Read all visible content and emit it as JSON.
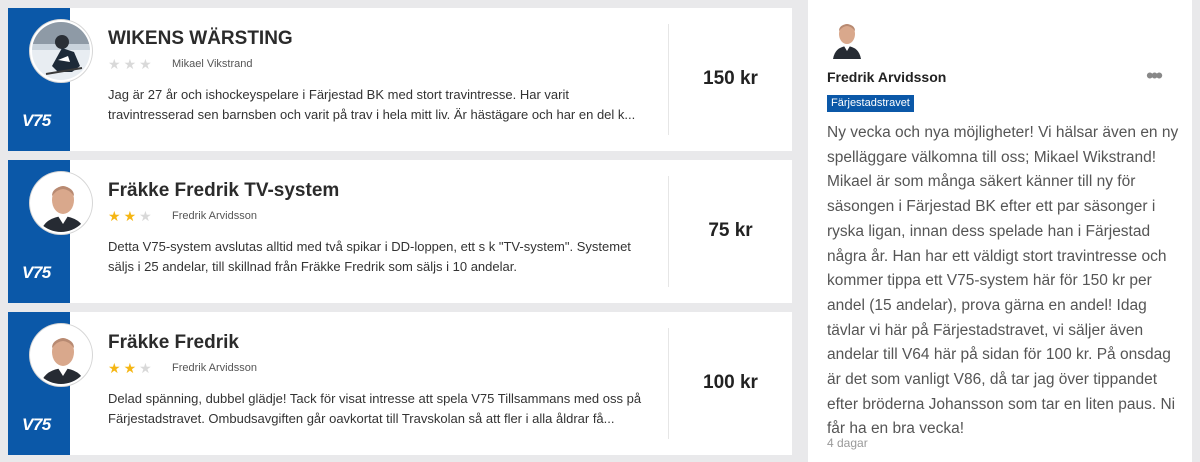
{
  "listings": [
    {
      "title": "WIKENS WÄRSTING",
      "author": "Mikael Vikstrand",
      "rating": 0,
      "rating_max": 3,
      "description": "Jag är 27 år och ishockeyspelare i Färjestad BK med stort travintresse. Har varit travintresserad sen barnsben och varit på trav i hela mitt liv. Är hästägare och har en del k...",
      "price": "150 kr",
      "game_badge": "V75",
      "avatar": "hockey-player-photo"
    },
    {
      "title": "Fräkke Fredrik TV-system",
      "author": "Fredrik Arvidsson",
      "rating": 2,
      "rating_max": 3,
      "description": "Detta V75-system avslutas alltid med två spikar i DD-loppen, ett s k \"TV-system\". Systemet säljs i 25 andelar, till skillnad från Fräkke Fredrik som säljs i 10 andelar.",
      "price": "75 kr",
      "game_badge": "V75",
      "avatar": "man-portrait-photo"
    },
    {
      "title": "Fräkke Fredrik",
      "author": "Fredrik Arvidsson",
      "rating": 2,
      "rating_max": 3,
      "description": "Delad spänning, dubbel glädje! Tack för visat intresse att spela V75 Tillsammans med oss på Färjestadstravet. Ombudsavgiften går oavkortat till Travskolan så att fler i alla åldrar få...",
      "price": "100 kr",
      "game_badge": "V75",
      "avatar": "man-portrait-photo"
    }
  ],
  "post": {
    "author": "Fredrik Arvidsson",
    "tag": "Färjestadstravet",
    "text": "Ny vecka och nya möjligheter! Vi hälsar även en ny spelläggare välkomna till oss; Mikael Wikstrand! Mikael är som många säkert känner till ny för säsongen i Färjestad BK efter ett par säsonger i ryska ligan, innan dess spelade han i Färjestad några år. Han har ett väldigt stort travintresse och kommer tippa ett V75-system här för 150 kr per andel (15 andelar), prova gärna en andel! Idag tävlar vi här på Färjestadstravet, vi säljer även andelar till V64 här på sidan för 100 kr. På onsdag är det som vanligt V86, då tar jag över tippandet efter bröderna Johansson som tar en liten paus. Ni får ha en bra vecka!",
    "time": "4 dagar",
    "more_icon": "more-horizontal-icon"
  },
  "colors": {
    "brand_blue": "#0b58a8",
    "star_on": "#f5b614",
    "star_off": "#d9d9d9"
  }
}
